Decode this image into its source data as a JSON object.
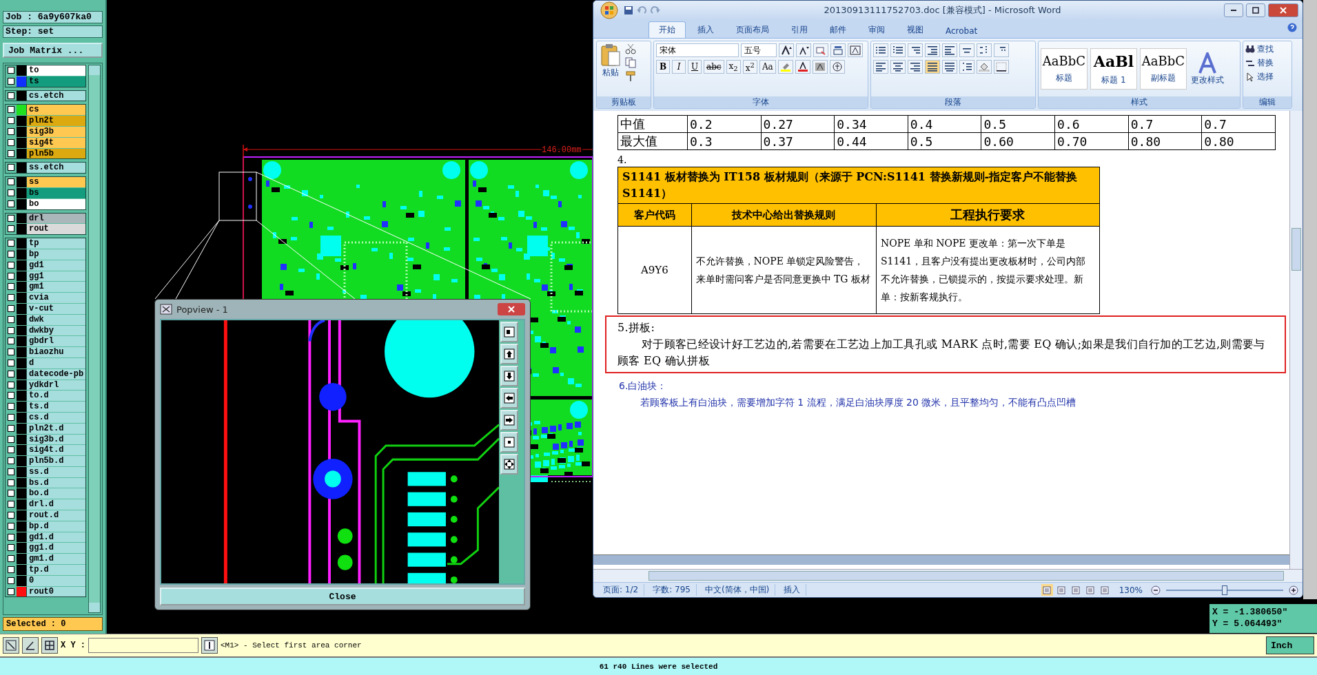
{
  "app": {
    "job": "Job : 6a9y607ka0",
    "step": "Step: set",
    "job_matrix_button": "Job Matrix ..."
  },
  "layer_groups": [
    {
      "layers": [
        {
          "name": "to",
          "color": "#ffffff",
          "checked": false
        },
        {
          "name": "ts",
          "color": "#139d7e",
          "swatch": {
            "color": "#1030ff"
          },
          "checked": false
        }
      ]
    },
    {
      "layers": [
        {
          "name": "cs.etch",
          "color": "#a6dede",
          "checked": false
        }
      ]
    },
    {
      "layers": [
        {
          "name": "cs",
          "color": "#ffc850",
          "swatch": {
            "color": "#20e020"
          },
          "checked": false
        },
        {
          "name": "pln2t",
          "color": "#dcaa10",
          "checked": false
        },
        {
          "name": "sig3b",
          "color": "#ffc850",
          "checked": false
        },
        {
          "name": "sig4t",
          "color": "#ffc850",
          "checked": false
        },
        {
          "name": "pln5b",
          "color": "#dcaa10",
          "checked": false
        }
      ]
    },
    {
      "layers": [
        {
          "name": "ss.etch",
          "color": "#a6dede",
          "checked": false
        }
      ]
    },
    {
      "layers": [
        {
          "name": "ss",
          "color": "#ffc850",
          "checked": false
        },
        {
          "name": "bs",
          "color": "#139d7e",
          "checked": false
        },
        {
          "name": "bo",
          "color": "#ffffff",
          "checked": false
        }
      ]
    },
    {
      "layers": [
        {
          "name": "drl",
          "color": "#a9b6ba",
          "checked": false
        },
        {
          "name": "rout",
          "color": "#dadada",
          "checked": false
        }
      ]
    },
    {
      "layers": [
        {
          "name": "tp",
          "color": "#a6dede",
          "checked": false
        },
        {
          "name": "bp",
          "color": "#a6dede",
          "checked": false
        },
        {
          "name": "gd1",
          "color": "#a6dede",
          "checked": false
        },
        {
          "name": "gg1",
          "color": "#a6dede",
          "checked": false
        },
        {
          "name": "gm1",
          "color": "#a6dede",
          "checked": false
        },
        {
          "name": "cvia",
          "color": "#a6dede",
          "checked": false
        },
        {
          "name": "v-cut",
          "color": "#a6dede",
          "checked": false
        },
        {
          "name": "dwk",
          "color": "#a6dede",
          "checked": false
        },
        {
          "name": "dwkby",
          "color": "#a6dede",
          "checked": false
        },
        {
          "name": "gbdrl",
          "color": "#a6dede",
          "checked": false
        },
        {
          "name": "biaozhu",
          "color": "#a6dede",
          "checked": false
        },
        {
          "name": "d",
          "color": "#a6dede",
          "checked": false
        },
        {
          "name": "datecode-pb",
          "color": "#a6dede",
          "checked": false
        },
        {
          "name": "ydkdrl",
          "color": "#a6dede",
          "checked": false
        },
        {
          "name": "to.d",
          "color": "#a6dede",
          "checked": false
        },
        {
          "name": "ts.d",
          "color": "#a6dede",
          "checked": false
        },
        {
          "name": "cs.d",
          "color": "#a6dede",
          "checked": false
        },
        {
          "name": "pln2t.d",
          "color": "#a6dede",
          "checked": false
        },
        {
          "name": "sig3b.d",
          "color": "#a6dede",
          "checked": false
        },
        {
          "name": "sig4t.d",
          "color": "#a6dede",
          "checked": false
        },
        {
          "name": "pln5b.d",
          "color": "#a6dede",
          "checked": false
        },
        {
          "name": "ss.d",
          "color": "#a6dede",
          "checked": false
        },
        {
          "name": "bs.d",
          "color": "#a6dede",
          "checked": false
        },
        {
          "name": "bo.d",
          "color": "#a6dede",
          "checked": false
        },
        {
          "name": "drl.d",
          "color": "#a6dede",
          "checked": false
        },
        {
          "name": "rout.d",
          "color": "#a6dede",
          "checked": false
        },
        {
          "name": "bp.d",
          "color": "#a6dede",
          "checked": false
        },
        {
          "name": "gd1.d",
          "color": "#a6dede",
          "checked": false
        },
        {
          "name": "gg1.d",
          "color": "#a6dede",
          "checked": false
        },
        {
          "name": "gm1.d",
          "color": "#a6dede",
          "checked": false
        },
        {
          "name": "tp.d",
          "color": "#a6dede",
          "checked": false
        },
        {
          "name": "0",
          "color": "#a6dede",
          "checked": false
        },
        {
          "name": "rout0",
          "color": "#a6dede",
          "swatch": {
            "color": "#ff1010"
          },
          "checked": false
        }
      ]
    }
  ],
  "selected_count": "Selected : 0",
  "canvas": {
    "dimension_label": "146.00mm"
  },
  "popview": {
    "title": "Popview - 1",
    "close_button": "Close"
  },
  "coordinates": [
    "X = -1.380650\"",
    "Y = 5.064493\""
  ],
  "toolbar": {
    "xy_label": "X Y :",
    "prompt": "<M1> - Select first area corner",
    "units": "Inch"
  },
  "status": "61 r40 Lines were selected",
  "word": {
    "title": "20130913111752703.doc [兼容模式] - Microsoft Word",
    "tabs": [
      {
        "label": "开始",
        "selected": true
      },
      {
        "label": "插入",
        "selected": false
      },
      {
        "label": "页面布局",
        "selected": false
      },
      {
        "label": "引用",
        "selected": false
      },
      {
        "label": "邮件",
        "selected": false
      },
      {
        "label": "审阅",
        "selected": false
      },
      {
        "label": "视图",
        "selected": false
      },
      {
        "label": "Acrobat",
        "selected": false
      }
    ],
    "ribbon": {
      "clipboard": {
        "paste": "粘贴",
        "label": "剪贴板"
      },
      "font": {
        "font_name": "宋体",
        "font_size": "五号",
        "format_buttons": [
          "B",
          "I",
          "U",
          "abc",
          "x$_{2}$",
          "x$^{2}$",
          "Aa"
        ],
        "label": "字体"
      },
      "paragraph": {
        "label": "段落"
      },
      "styles": {
        "items": [
          {
            "preview": "AaBbC",
            "name": "标题"
          },
          {
            "preview": "AaBl",
            "name": "标题 1"
          },
          {
            "preview": "AaBbC",
            "name": "副标题"
          }
        ],
        "change_styles": "更改样式",
        "label": "样式"
      },
      "editing": {
        "items": [
          "查找",
          "替换",
          "选择"
        ],
        "label": "编辑"
      }
    },
    "document": {
      "value_table": [
        {
          "label": "中值",
          "values": [
            "0.2",
            "0.27",
            "0.34",
            "0.4",
            "0.5",
            "0.6",
            "0.7",
            "0.7"
          ]
        },
        {
          "label": "最大值",
          "values": [
            "0.3",
            "0.37",
            "0.44",
            "0.5",
            "0.60",
            "0.70",
            "0.80",
            "0.80"
          ]
        }
      ],
      "item_4": "4.",
      "rule_table": {
        "title": "S1141 板材替换为 IT158 板材规则（来源于 PCN:S1141 替换新规则-指定客户不能替换 S1141）",
        "columns": [
          "客户代码",
          "技术中心给出替换规则",
          "工程执行要求"
        ],
        "rows": [
          [
            "A9Y6",
            "不允许替换，NOPE 单锁定风险警告，来单时需问客户是否同意更换中 TG 板材",
            "NOPE 单和 NOPE 更改单：第一次下单是 S1141，且客户没有提出更改板材时，公司内部不允许替换，已锁提示的，按提示要求处理。新单：按新客规执行。"
          ]
        ]
      },
      "section_5": {
        "heading": "5.拼板:",
        "body": "对于顾客已经设计好工艺边的,若需要在工艺边上加工具孔或 MARK 点时,需要 EQ 确认;如果是我们自行加的工艺边,则需要与顾客 EQ 确认拼板",
        "highlighted": true
      },
      "section_6": {
        "heading": "6.白油块：",
        "body": "若顾客板上有白油块，需要增加字符 1 流程，满足白油块厚度 20 微米，且平整均匀，不能有凸点凹槽"
      }
    },
    "status_bar": {
      "items": [
        "页面: 1/2",
        "字数: 795",
        "中文(简体，中国)",
        "插入"
      ],
      "view_buttons": [
        {
          "selected": true
        },
        {
          "selected": false
        },
        {
          "selected": false
        },
        {
          "selected": false
        },
        {
          "selected": false
        }
      ],
      "zoom": "130%",
      "zoom_slider": {
        "level": 0.5
      }
    }
  }
}
